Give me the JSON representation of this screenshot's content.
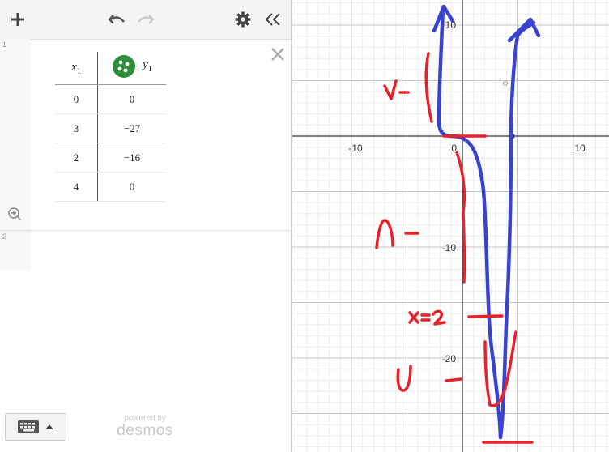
{
  "toolbar": {
    "add_icon": "plus-icon",
    "undo_icon": "undo-icon",
    "redo_icon": "redo-icon",
    "settings_icon": "gear-icon",
    "collapse_icon": "double-chevron-left-icon"
  },
  "expressions": [
    {
      "index": "1",
      "type": "table",
      "columns": [
        {
          "name": "x",
          "sub": "1"
        },
        {
          "name": "y",
          "sub": "1",
          "point_color": "#2d8e3a"
        }
      ],
      "rows": [
        [
          "0",
          "0"
        ],
        [
          "3",
          "−27"
        ],
        [
          "2",
          "−16"
        ],
        [
          "4",
          "0"
        ]
      ]
    },
    {
      "index": "2",
      "type": "empty"
    }
  ],
  "branding": {
    "powered": "powered by",
    "name": "desmos"
  },
  "graph": {
    "x_ticks": [
      "-10",
      "0",
      "10"
    ],
    "y_ticks": [
      "10",
      "-10",
      "-20"
    ],
    "axis_range_x": [
      -15,
      12
    ],
    "axis_range_y": [
      -27,
      12
    ],
    "ink_colors": {
      "red": "#e8222a",
      "blue": "#3a43cf"
    },
    "annotations": [
      "v-",
      "∩-",
      "x=2",
      "∪-"
    ]
  }
}
